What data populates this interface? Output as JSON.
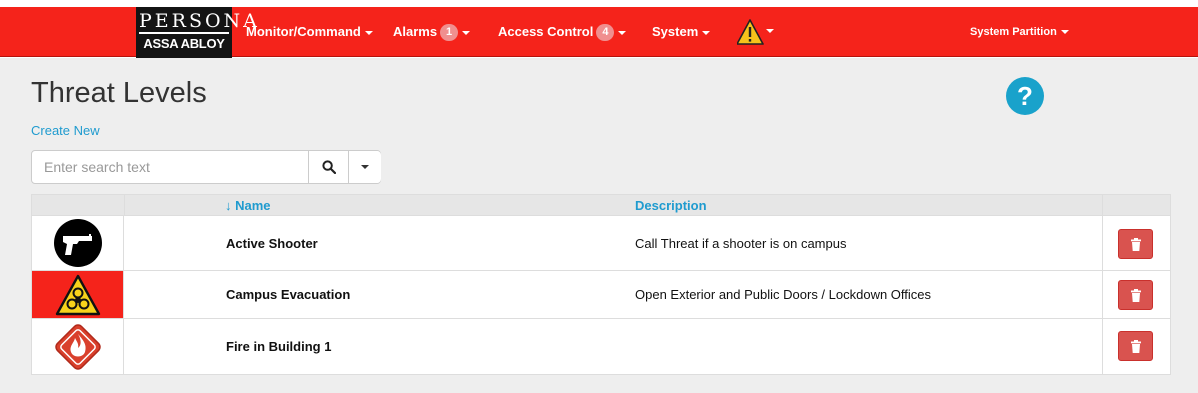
{
  "brand": {
    "top": "PERSONA",
    "bottom": "ASSA ABLOY"
  },
  "nav": {
    "monitor_label": "Monitor/Command",
    "alarms_label": "Alarms",
    "alarms_count": "1",
    "access_label": "Access Control",
    "access_count": "4",
    "system_label": "System",
    "warning_icon": "warning-triangle-icon",
    "partition_label": "System Partition"
  },
  "page": {
    "title": "Threat Levels",
    "create_new": "Create New",
    "help_icon": "question-circle-icon"
  },
  "search": {
    "placeholder": "Enter search text"
  },
  "table": {
    "columns": {
      "sort_indicator": "↓",
      "name": "Name",
      "description": "Description"
    },
    "rows": [
      {
        "name": "Active Shooter",
        "description": "Call Threat if a shooter is on campus",
        "icon": "gun-icon"
      },
      {
        "name": "Campus Evacuation",
        "description": "Open Exterior and Public Doors / Lockdown Offices",
        "icon": "biohazard-icon"
      },
      {
        "name": "Fire in Building 1",
        "description": "",
        "icon": "fire-icon"
      }
    ]
  },
  "colors": {
    "navbar": "#f5231b",
    "link": "#1f9bcf",
    "delete": "#d9534f",
    "help": "#19a2cb"
  }
}
